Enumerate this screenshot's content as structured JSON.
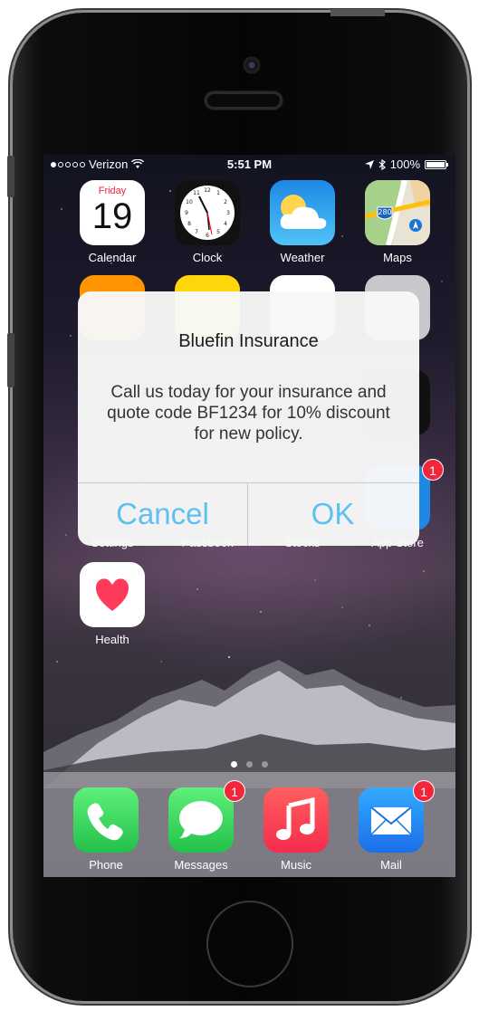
{
  "status_bar": {
    "carrier": "Verizon",
    "time": "5:51 PM",
    "battery": "100%"
  },
  "home": {
    "calendar": {
      "label": "Calendar",
      "weekday": "Friday",
      "day": "19"
    },
    "clock": {
      "label": "Clock"
    },
    "weather": {
      "label": "Weather"
    },
    "maps": {
      "label": "Maps",
      "highway": "280"
    },
    "settings": {
      "label": "Settings"
    },
    "passbook": {
      "label": "Passbook"
    },
    "stocks": {
      "label": "Stocks"
    },
    "app_store": {
      "label": "App Store",
      "badge": "1"
    },
    "health": {
      "label": "Health"
    }
  },
  "dock": {
    "phone": {
      "label": "Phone"
    },
    "messages": {
      "label": "Messages",
      "badge": "1"
    },
    "music": {
      "label": "Music"
    },
    "mail": {
      "label": "Mail",
      "badge": "1"
    }
  },
  "alert": {
    "title": "Bluefin Insurance",
    "message": "Call us today for your insurance and quote code BF1234 for 10% discount for new policy.",
    "cancel_label": "Cancel",
    "ok_label": "OK"
  },
  "colors": {
    "alert_button": "#5ec0f0",
    "badge": "#f2263a"
  }
}
